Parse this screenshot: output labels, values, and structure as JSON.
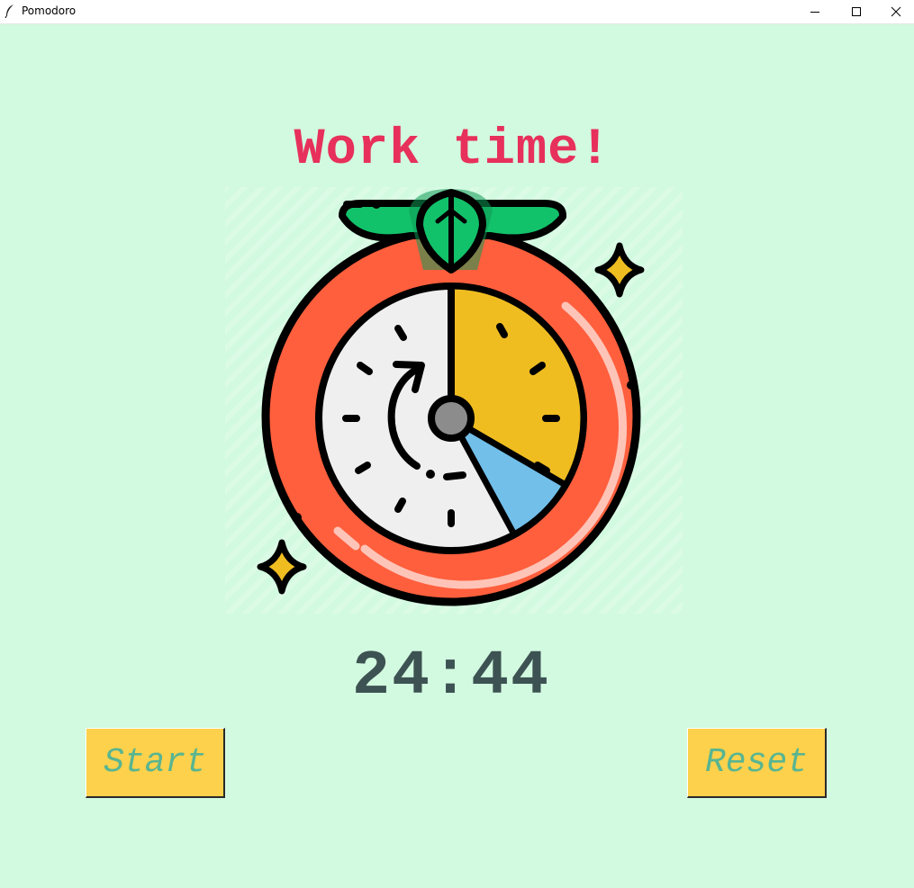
{
  "window": {
    "title": "Pomodoro",
    "controls": {
      "minimize": "minimize-icon",
      "maximize": "maximize-icon",
      "close": "close-icon"
    }
  },
  "main": {
    "heading": "Work time!",
    "timer": "24:44",
    "start_label": "Start",
    "reset_label": "Reset"
  },
  "colors": {
    "background": "#d2fae0",
    "heading": "#e7305b",
    "timer": "#3d5252",
    "button_bg": "#fdd14b",
    "button_text": "#58b591",
    "tomato": "#ff5f3d",
    "leaf": "#12c26a",
    "clock_face": "#efefef",
    "clock_yellow": "#f0bd21",
    "clock_blue": "#72bfea"
  },
  "icons": {
    "app": "feather-icon",
    "illustration": "tomato-timer-icon",
    "sparkles": "sparkle-icon"
  }
}
